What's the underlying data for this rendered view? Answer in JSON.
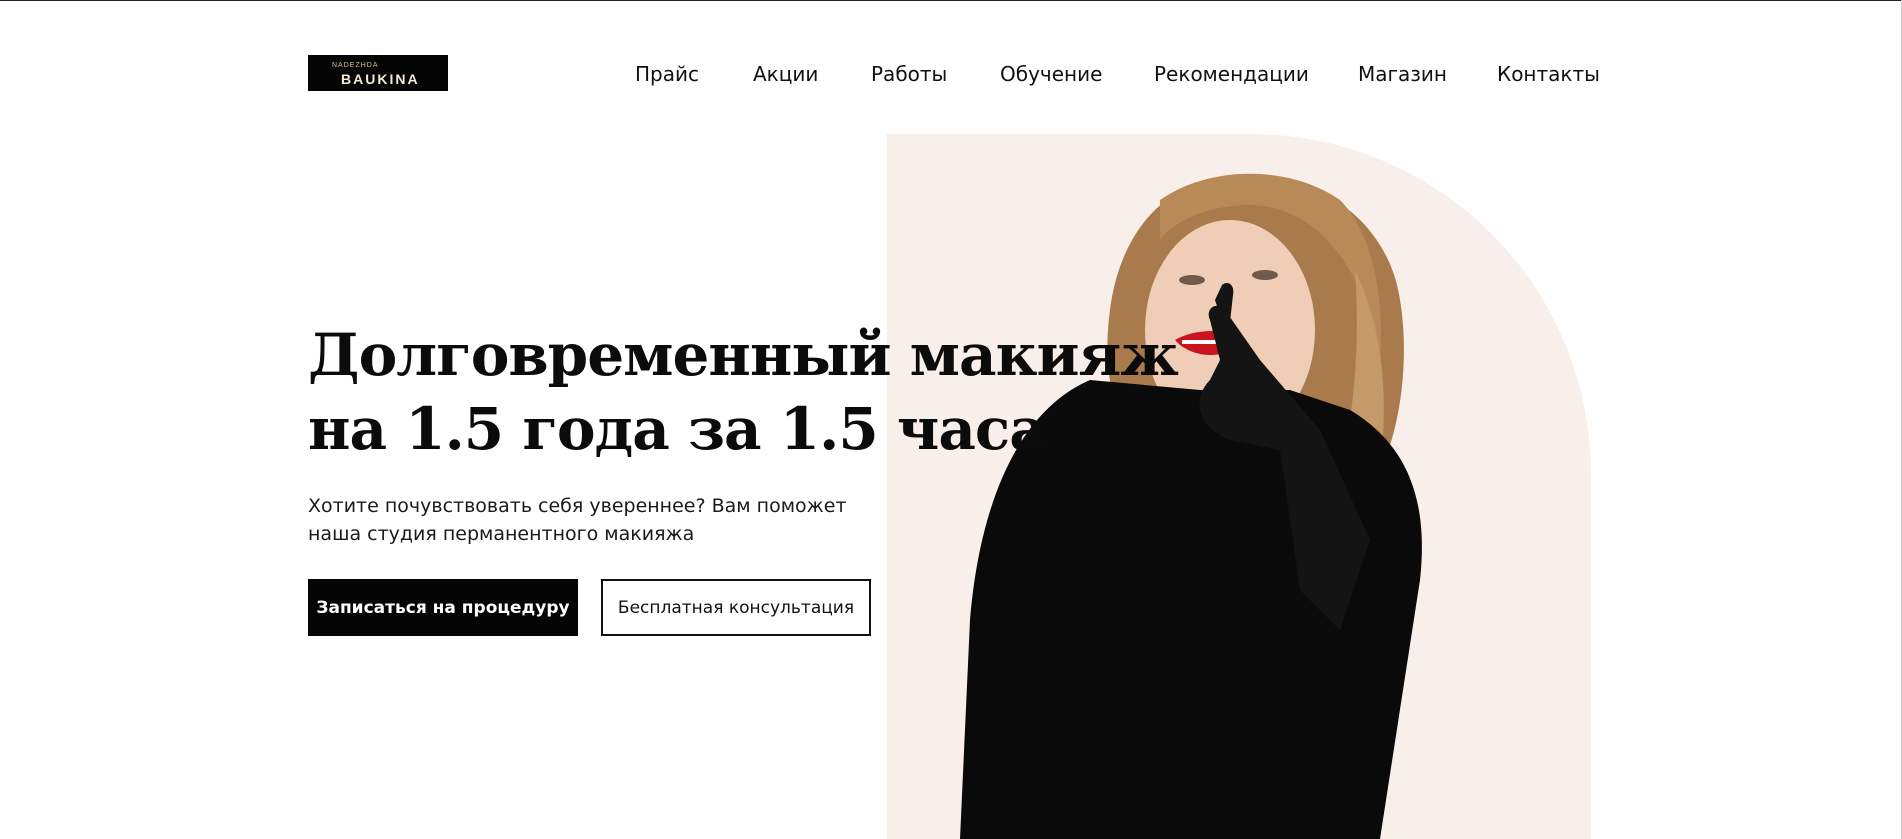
{
  "logo": {
    "top_text": "NADEZHDA",
    "name": "BAUKINA"
  },
  "nav": {
    "items": [
      {
        "label": "Прайс"
      },
      {
        "label": "Акции"
      },
      {
        "label": "Работы"
      },
      {
        "label": "Обучение"
      },
      {
        "label": "Рекомендации"
      },
      {
        "label": "Магазин"
      },
      {
        "label": "Контакты"
      }
    ]
  },
  "hero": {
    "title_line_1": "Долговременный макияж",
    "title_line_2": "на 1.5 года за 1.5 часа",
    "subtitle_line_1": "Хотите почувствовать себя увереннее? Вам поможет",
    "subtitle_line_2": "наша студия перманентного макияжа",
    "primary_button": "Записаться на процедуру",
    "secondary_button": "Бесплатная консультация"
  },
  "colors": {
    "accent_background": "#f9efea",
    "primary_button_bg": "#050505",
    "text": "#111111"
  }
}
